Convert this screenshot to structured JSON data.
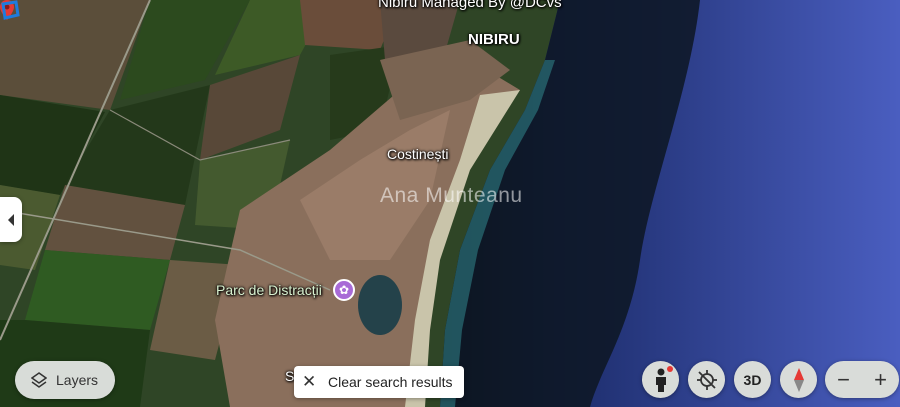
{
  "map": {
    "place_labels": {
      "nibiru_managed": "Nibiru Managed By @DCvs",
      "nibiru": "NIBIRU",
      "costinesti": "Costinești",
      "parc": "Parc de Distracții",
      "partial_label": "S"
    },
    "watermark": "Ana Munteanu",
    "colors": {
      "sea": "#3a4fb5",
      "land": "#2f4a26",
      "pin": "#e53935",
      "poi": "#a86bd6",
      "marker": "#1e7bdc"
    }
  },
  "controls": {
    "layers_label": "Layers",
    "clear_search_label": "Clear search results",
    "threed_label": "3D",
    "zoom_out": "−",
    "zoom_in": "+",
    "icons": [
      "layers-icon",
      "close-icon",
      "pegman-icon",
      "locate-off-icon",
      "compass-icon",
      "chevron-left-icon"
    ]
  }
}
